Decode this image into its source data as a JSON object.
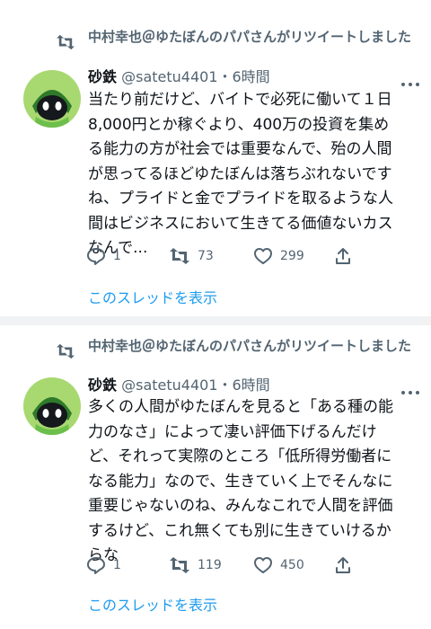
{
  "tweets": [
    {
      "retweet_text": "中村幸也＠ゆたぼんのパパさんがリツイートしました",
      "name": "砂鉄",
      "handle": "@satetu4401",
      "time": "・6時間",
      "body": "当たり前だけど、バイトで必死に働いて１日\n8,000円とか稼ぐより、400万の投資を集め\nる能力の方が社会では重要なんで、殆の人間\nが思ってるほどゆたぼんは落ちぶれないです\nね、プライドと金でプライドを取るような人\n間はビジネスにおいて生きてる価値ないカス\nなんで...",
      "replies": "1",
      "retweets": "73",
      "likes": "299",
      "show_thread": "このスレッドを表示"
    },
    {
      "retweet_text": "中村幸也＠ゆたぼんのパパさんがリツイートしました",
      "name": "砂鉄",
      "handle": "@satetu4401",
      "time": "・6時間",
      "body": "多くの人間がゆたぼんを見ると「ある種の能\n力のなさ」によって凄い評価下げるんだけ\nど、それって実際のところ「低所得労働者に\nなる能力」なので、生きていく上でそんなに\n重要じゃないのね、みんなこれで人間を評価\nするけど、これ無くても別に生きていけるか\nらな",
      "replies": "1",
      "retweets": "119",
      "likes": "450",
      "show_thread": "このスレッドを表示"
    }
  ],
  "colors": {
    "accent": "#1d9bf0",
    "secondary_text": "#536471",
    "divider": "#f0f2f4"
  },
  "icons": [
    "retweet-icon",
    "reply-icon",
    "like-icon",
    "share-icon",
    "more-icon"
  ]
}
